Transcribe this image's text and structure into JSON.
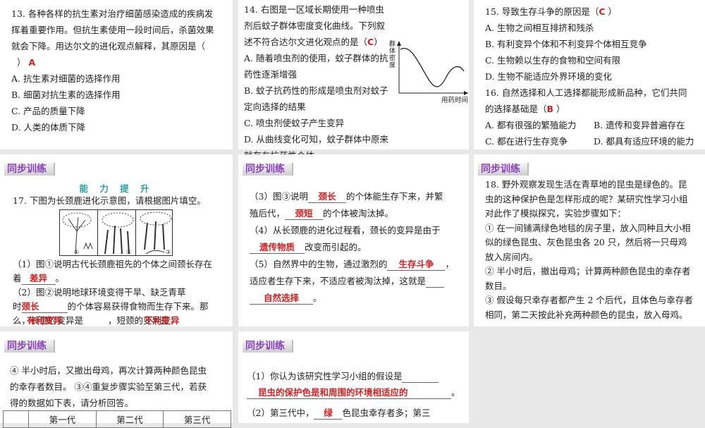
{
  "q13": {
    "stem": [
      "13. 各种各样的抗生素对治疗细菌感染造成的疾病发",
      "挥着重要作用。但抗生素使用一段时间后，杀菌效果",
      "就会下降。用达尔文的进化观点解释，其原因是（"
    ],
    "close": "）",
    "answer": "A",
    "options": [
      "A. 抗生素对细菌的选择作用",
      "B. 细菌对抗生素的选择作用",
      "C. 产品的质量下降",
      "D. 人类的体质下降"
    ]
  },
  "q14": {
    "stem": [
      "14. 右图是一区域长期使用一种喷虫",
      "剂后蚊子群体密度变化曲线。下列叙"
    ],
    "stem3": "述不符合达尔文进化观点的是（",
    "answer": "C",
    "close": "）",
    "options": [
      "A. 随着喷虫剂的使用，蚊子群体的抗",
      "药性逐渐增强",
      "B. 蚊子抗药性的形成是喷虫剂对蚊子",
      "定向选择的结果",
      "C. 喷虫剂使蚊子产生变异",
      "D. 从曲线变化可知，蚊子群体中原来",
      "就存在抗药性个体"
    ],
    "graph": {
      "ylabel": "群体密度",
      "xlabel": "用药时间"
    }
  },
  "q15": {
    "stem": "15. 导致生存斗争的原因是（",
    "answer": "C",
    "close": "）",
    "options": [
      "A. 生物之间相互排挤和残杀",
      "B. 有利变异个体和不利变异个体相互竞争",
      "C. 生物赖以生存的食物和空间有限",
      "D. 生物不能适应外界环境的变化"
    ]
  },
  "q16": {
    "stem1": "16. 自然选择和人工选择都能形成新品种，它们共同",
    "stem2": "的选择基础是（",
    "answer": "B",
    "close": "）",
    "options": [
      "A. 都有很强的繁殖能力",
      "B. 遗传和变异普遍存在",
      "C. 都在进行生存竞争",
      "D. 都具有适应环境的能力"
    ]
  },
  "badge": "同步训练",
  "q17": {
    "section": "能 力 提 升",
    "stem": "17. 下图为长颈鹿进化示意图，请根据图片填空。",
    "figure_labels": [
      "①",
      "②",
      "③"
    ],
    "p1a": "（1）图①说明古代长颈鹿祖先的个体之间颈长存在",
    "p1b": "着",
    "a1": "差异",
    "p1c": "。",
    "p2a": "（2）图②说明地球环境变得干旱、缺乏青草",
    "p2b": "时",
    "a2": "颈长",
    "p2c": "的个体容易获得食物而生存下来。那",
    "p2d": "么，长颈的变异是",
    "a3": "有利变异",
    "p2e": "，短颈的变异是",
    "a4": "不利变异",
    "p2f": "。",
    "p3a": "（3）图③说明",
    "a5": "颈长",
    "p3b": "的个体能生存下来，并繁",
    "p3c": "殖后代，",
    "a6": "颈短",
    "p3d": "的个体被淘汰掉。",
    "p4a": "（4）从长颈鹿的进化过程看，颈长的变异是由于",
    "a7": "遗传物质",
    "p4b": "改变而引起的。",
    "p5a": "（5）自然界中的生物，通过激烈的",
    "a8": "生存斗争",
    "p5b": "，",
    "p5c": "适应者生存下来，不适应者被淘汰掉，这就是",
    "a9": "自然选择",
    "p5d": "。"
  },
  "q18": {
    "lines": [
      "18. 野外观察发现生活在青草地的昆虫是绿色的。昆",
      "虫的这种保护色是怎样形成的呢？某研究性学习小组",
      "对此作了模拟探究，实验步骤如下：",
      "① 在一间铺满绿色地毯的房子里，放入同种且大小相",
      "似的绿色昆虫、灰色昆虫各 20 只，然后将一只母鸡",
      "放入房间内。",
      "② 半小时后，撤出母鸡；计算两种颜色昆虫的幸存者",
      "数目。",
      "③ 假设每只幸存者都产生 2 个后代，且体色与幸存者",
      "相同，第二天按此补充两种颜色的昆虫，放入母鸡。"
    ],
    "cont": [
      "④ 半小时后，又撤出母鸡，再次计算两种颜色昆虫",
      "的幸存者数目。 ③④重复步骤实验至第三代，若获",
      "得的数据如下表，请分析回答。"
    ],
    "table_headers": [
      "",
      "第一代",
      "第二代",
      "第三代"
    ],
    "s1a": "（1）你认为该研究性学习小组的假设是",
    "s1ans": "昆虫的保护色是和周围的环境相适应的",
    "s1b": "。",
    "s2a": "（2）第三代中，",
    "s2ans": "绿",
    "s2b": "色昆虫幸存者多；第三"
  }
}
